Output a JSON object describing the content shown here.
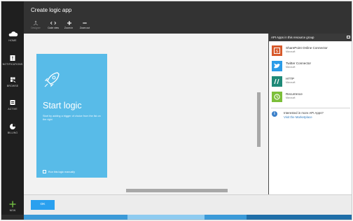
{
  "header": {
    "title": "Create logic app"
  },
  "toolbar": {
    "items": [
      {
        "label": "Designer",
        "icon": "designer-icon",
        "enabled": false
      },
      {
        "label": "Code view",
        "icon": "code-icon",
        "enabled": true
      },
      {
        "label": "Zoom in",
        "icon": "plus-icon",
        "enabled": true
      },
      {
        "label": "Zoom out",
        "icon": "minus-icon",
        "enabled": true
      }
    ]
  },
  "nav": {
    "items": [
      {
        "label": "HOME",
        "icon": "cloud-icon"
      },
      {
        "label": "NOTIFICATIONS",
        "icon": "notification-icon"
      },
      {
        "label": "BROWSE",
        "icon": "browse-icon"
      },
      {
        "label": "ACTIVE",
        "icon": "active-icon"
      },
      {
        "label": "BILLING",
        "icon": "billing-icon"
      }
    ],
    "new_label": "NEW"
  },
  "canvas": {
    "tile": {
      "title": "Start logic",
      "description": "Start by adding a trigger of choice from the list on the right",
      "checkbox_label": "Run this logic manually",
      "color": "#58bbe8"
    }
  },
  "panel": {
    "title": "API Apps in this resource group",
    "apps": [
      {
        "name": "SharePoint Online Connector",
        "publisher": "Microsoft",
        "icon": "sharepoint-icon",
        "color": "#d75a2c"
      },
      {
        "name": "Twitter Connector",
        "publisher": "Microsoft",
        "icon": "twitter-icon",
        "color": "#2b9ce8"
      },
      {
        "name": "HTTP",
        "publisher": "Microsoft",
        "icon": "http-icon",
        "color": "#1f8a78"
      },
      {
        "name": "Recurrence",
        "publisher": "Microsoft",
        "icon": "recurrence-icon",
        "color": "#7cbf3a"
      }
    ],
    "more_question": "Interested in more API Apps?",
    "more_link": "Visit the Marketplace"
  },
  "footer": {
    "ok_label": "OK",
    "accent": "#2aa0ef"
  }
}
